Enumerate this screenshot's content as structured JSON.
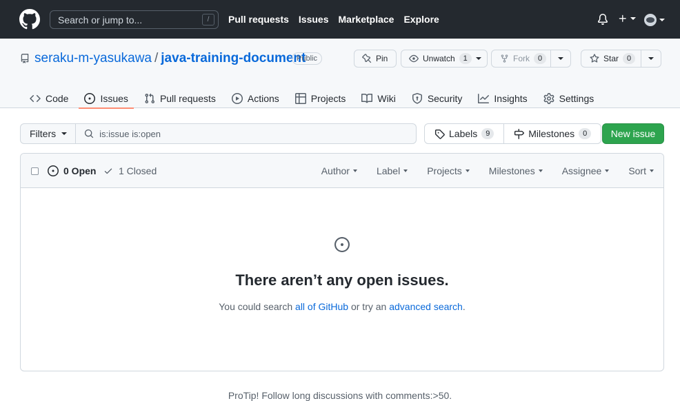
{
  "header": {
    "search_placeholder": "Search or jump to...",
    "slash_hint": "/",
    "nav": [
      "Pull requests",
      "Issues",
      "Marketplace",
      "Explore"
    ]
  },
  "repo": {
    "owner": "seraku-m-yasukawa",
    "separator": "/",
    "name": "java-training-document",
    "visibility": "Public",
    "actions": {
      "pin_label": "Pin",
      "watch_label": "Unwatch",
      "watch_count": "1",
      "fork_label": "Fork",
      "fork_count": "0",
      "star_label": "Star",
      "star_count": "0"
    },
    "tabs": [
      "Code",
      "Issues",
      "Pull requests",
      "Actions",
      "Projects",
      "Wiki",
      "Security",
      "Insights",
      "Settings"
    ],
    "active_tab": "Issues"
  },
  "issues": {
    "filters_label": "Filters",
    "query": "is:issue is:open",
    "labels_label": "Labels",
    "labels_count": "9",
    "milestones_label": "Milestones",
    "milestones_count": "0",
    "new_issue_label": "New issue",
    "open_label": "0 Open",
    "closed_label": "1 Closed",
    "column_filters": [
      "Author",
      "Label",
      "Projects",
      "Milestones",
      "Assignee",
      "Sort"
    ],
    "blankslate": {
      "title": "There aren’t any open issues.",
      "text_prefix": "You could search ",
      "link_all": "all of GitHub",
      "text_middle": " or try an ",
      "link_advanced": "advanced search",
      "text_suffix": "."
    }
  },
  "footer": {
    "protip": "ProTip! Follow long discussions with comments:>50."
  },
  "colors": {
    "header_bg": "#24292f",
    "link": "#0969da",
    "primary_button": "#2da44e",
    "active_tab_underline": "#fd8c73"
  }
}
